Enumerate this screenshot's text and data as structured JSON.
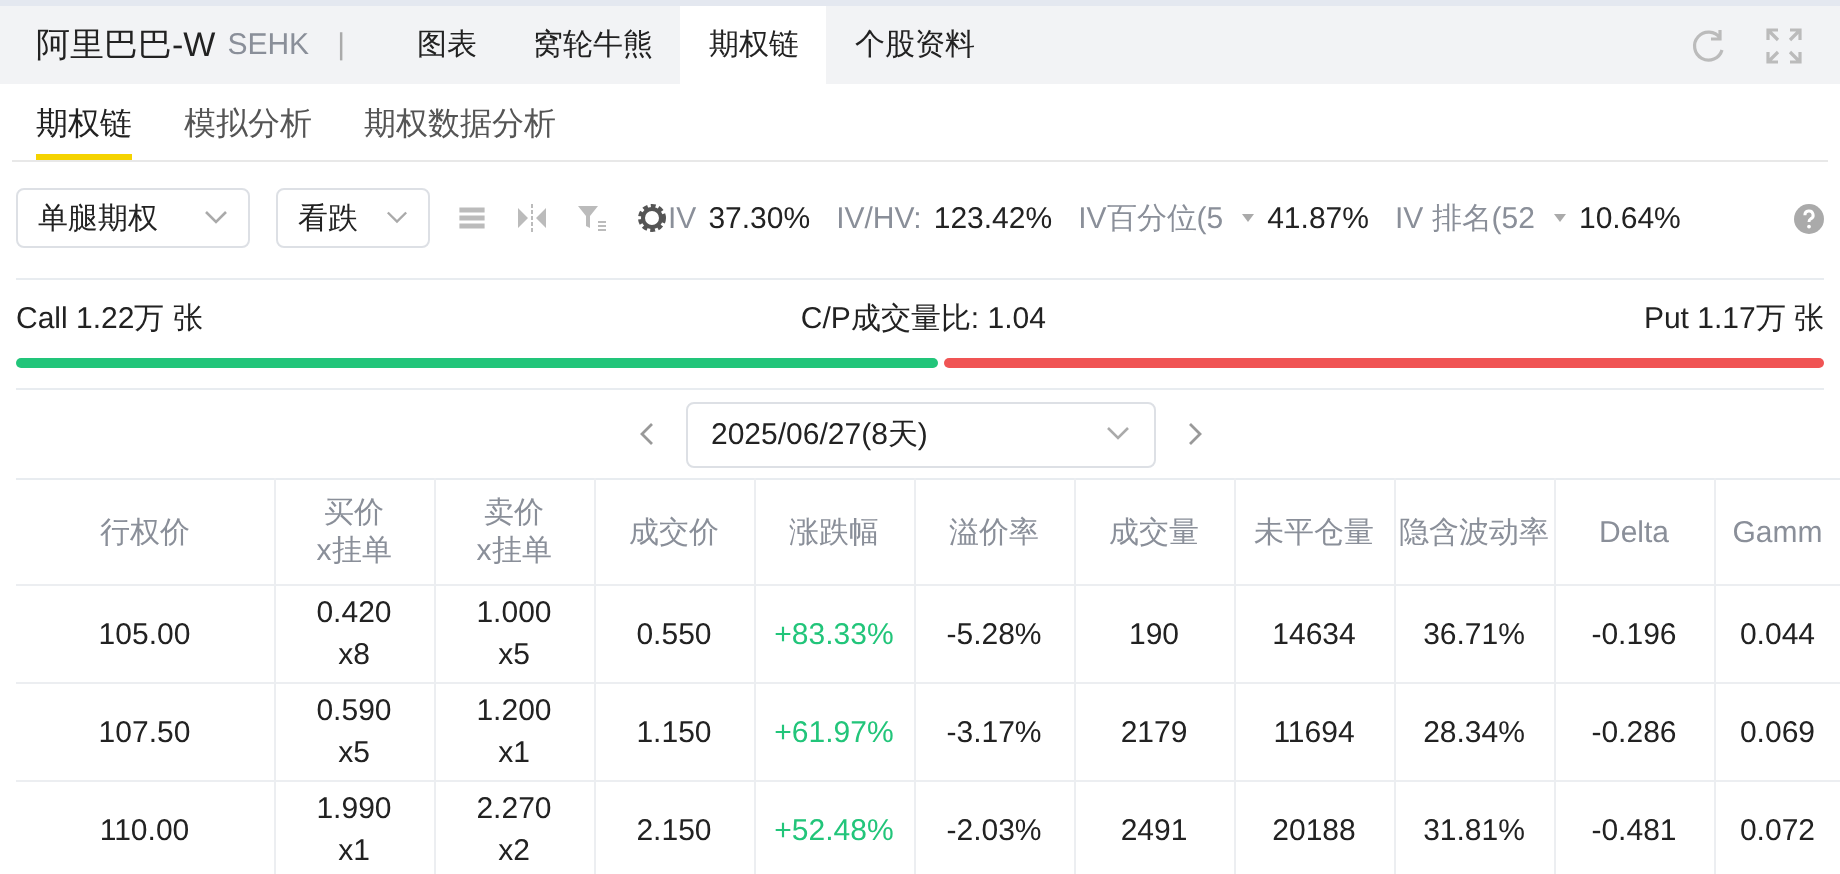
{
  "header": {
    "title": "阿里巴巴-W",
    "market": "SEHK",
    "separator": "|"
  },
  "tabs": [
    {
      "label": "图表",
      "selected": false
    },
    {
      "label": "窝轮牛熊",
      "selected": false
    },
    {
      "label": "期权链",
      "selected": true
    },
    {
      "label": "个股资料",
      "selected": false
    }
  ],
  "subtabs": [
    {
      "label": "期权链",
      "selected": true
    },
    {
      "label": "模拟分析",
      "selected": false
    },
    {
      "label": "期权数据分析",
      "selected": false
    }
  ],
  "toolbar": {
    "selects": [
      "单腿期权",
      "看跌"
    ],
    "metrics": [
      {
        "label": "IV",
        "value": "37.30%",
        "dropdown": false
      },
      {
        "label": "IV/HV:",
        "value": "123.42%",
        "dropdown": false
      },
      {
        "label": "IV百分位(5",
        "value": "41.87%",
        "dropdown": true
      },
      {
        "label": "IV 排名(52",
        "value": "10.64%",
        "dropdown": true
      }
    ]
  },
  "volume": {
    "call": "Call 1.22万 张",
    "ratio": "C/P成交量比: 1.04",
    "put": "Put 1.17万 张",
    "level": 0.51
  },
  "expiry": {
    "date": "2025/06/27(8天)"
  },
  "table": {
    "columns": [
      "行权价",
      "买价\nx挂单",
      "卖价\nx挂单",
      "成交价",
      "涨跌幅",
      "溢价率",
      "成交量",
      "未平仓量",
      "隐含波动率",
      "Delta",
      "Gamm"
    ],
    "rows": [
      [
        "105.00",
        "0.420\nx8",
        "1.000\nx5",
        "0.550",
        "+83.33%",
        "-5.28%",
        "190",
        "14634",
        "36.71%",
        "-0.196",
        "0.044"
      ],
      [
        "107.50",
        "0.590\nx5",
        "1.200\nx1",
        "1.150",
        "+61.97%",
        "-3.17%",
        "2179",
        "11694",
        "28.34%",
        "-0.286",
        "0.069"
      ],
      [
        "110.00",
        "1.990\nx1",
        "2.270\nx2",
        "2.150",
        "+52.48%",
        "-2.03%",
        "2491",
        "20188",
        "31.81%",
        "-0.481",
        "0.072"
      ]
    ]
  }
}
